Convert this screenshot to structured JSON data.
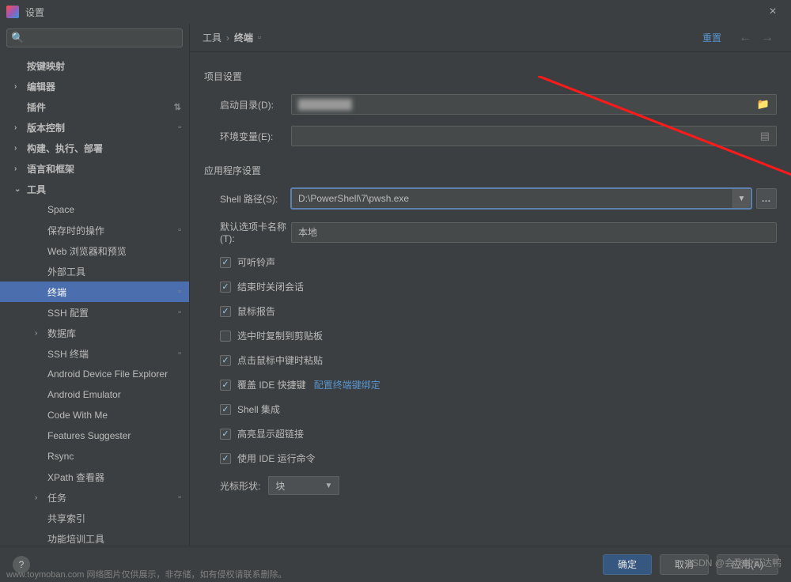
{
  "window": {
    "title": "设置"
  },
  "search": {
    "placeholder": ""
  },
  "sidebar": {
    "items": [
      {
        "label": "按键映射",
        "bold": true,
        "level": 1
      },
      {
        "label": "编辑器",
        "bold": true,
        "level": 1,
        "arrow": "›"
      },
      {
        "label": "插件",
        "bold": true,
        "level": 1,
        "badge": "⇅"
      },
      {
        "label": "版本控制",
        "bold": true,
        "level": 1,
        "arrow": "›",
        "badge": "▫"
      },
      {
        "label": "构建、执行、部署",
        "bold": true,
        "level": 1,
        "arrow": "›"
      },
      {
        "label": "语言和框架",
        "bold": true,
        "level": 1,
        "arrow": "›"
      },
      {
        "label": "工具",
        "bold": true,
        "level": 1,
        "arrow": "⌄"
      },
      {
        "label": "Space",
        "level": 2
      },
      {
        "label": "保存时的操作",
        "level": 2,
        "badge": "▫"
      },
      {
        "label": "Web 浏览器和预览",
        "level": 2
      },
      {
        "label": "外部工具",
        "level": 2
      },
      {
        "label": "终端",
        "level": 2,
        "selected": true,
        "badge": "▫"
      },
      {
        "label": "SSH 配置",
        "level": 2,
        "badge": "▫"
      },
      {
        "label": "数据库",
        "level": 2,
        "arrow": "›"
      },
      {
        "label": "SSH 终端",
        "level": 2,
        "badge": "▫"
      },
      {
        "label": "Android Device File Explorer",
        "level": 2
      },
      {
        "label": "Android Emulator",
        "level": 2
      },
      {
        "label": "Code With Me",
        "level": 2
      },
      {
        "label": "Features Suggester",
        "level": 2
      },
      {
        "label": "Rsync",
        "level": 2
      },
      {
        "label": "XPath 查看器",
        "level": 2
      },
      {
        "label": "任务",
        "level": 2,
        "arrow": "›",
        "badge": "▫"
      },
      {
        "label": "共享索引",
        "level": 2
      },
      {
        "label": "功能培训工具",
        "level": 2
      }
    ]
  },
  "breadcrumb": {
    "root": "工具",
    "current": "终端",
    "reset": "重置"
  },
  "sections": {
    "project_title": "项目设置",
    "startup_dir_label": "启动目录(D):",
    "startup_dir_value": "████████",
    "env_label": "环境变量(E):",
    "env_value": "",
    "app_title": "应用程序设置",
    "shell_label": "Shell 路径(S):",
    "shell_value": "D:\\PowerShell\\7\\pwsh.exe",
    "tab_label": "默认选项卡名称(T):",
    "tab_value": "本地",
    "checks": [
      {
        "label": "可听铃声",
        "checked": true
      },
      {
        "label": "结束时关闭会话",
        "checked": true
      },
      {
        "label": "鼠标报告",
        "checked": true
      },
      {
        "label": "选中时复制到剪贴板",
        "checked": false
      },
      {
        "label": "点击鼠标中键时粘贴",
        "checked": true
      },
      {
        "label": "覆盖 IDE 快捷键",
        "checked": true,
        "link": "配置终端键绑定"
      },
      {
        "label": "Shell 集成",
        "checked": true
      },
      {
        "label": "高亮显示超链接",
        "checked": true
      },
      {
        "label": "使用 IDE 运行命令",
        "checked": true
      }
    ],
    "cursor_label": "光标形状:",
    "cursor_value": "块"
  },
  "footer": {
    "ok": "确定",
    "cancel": "取消",
    "apply": "应用(A)"
  },
  "watermark": "CSDN @会飞的可达鸭",
  "watermark2": "www.toymoban.com 网络图片仅供展示，非存储，如有侵权请联系删除。"
}
